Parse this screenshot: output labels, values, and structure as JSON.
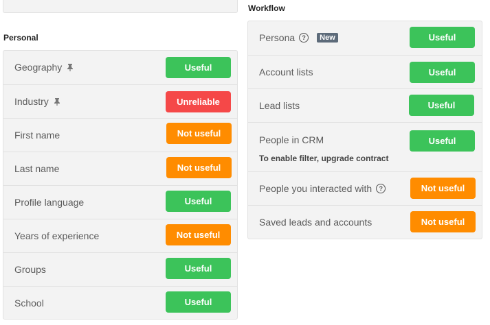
{
  "personal": {
    "heading": "Personal",
    "rows": [
      {
        "label": "Geography",
        "pinned": true,
        "status": "Useful",
        "status_kind": "useful"
      },
      {
        "label": "Industry",
        "pinned": true,
        "status": "Unreliable",
        "status_kind": "unreliable"
      },
      {
        "label": "First name",
        "status": "Not useful",
        "status_kind": "notuseful"
      },
      {
        "label": "Last name",
        "status": "Not useful",
        "status_kind": "notuseful"
      },
      {
        "label": "Profile language",
        "status": "Useful",
        "status_kind": "useful"
      },
      {
        "label": "Years of experience",
        "status": "Not useful",
        "status_kind": "notuseful"
      },
      {
        "label": "Groups",
        "status": "Useful",
        "status_kind": "useful"
      },
      {
        "label": "School",
        "status": "Useful",
        "status_kind": "useful"
      }
    ]
  },
  "workflow": {
    "heading": "Workflow",
    "rows": [
      {
        "label": "Persona",
        "help": true,
        "badge": "New",
        "status": "Useful",
        "status_kind": "useful"
      },
      {
        "label": "Account lists",
        "status": "Useful",
        "status_kind": "useful"
      },
      {
        "label": "Lead lists",
        "status": "Useful",
        "status_kind": "useful"
      },
      {
        "label": "People in CRM",
        "subtext": "To enable filter, upgrade contract",
        "status": "Useful",
        "status_kind": "useful"
      },
      {
        "label": "People you interacted with",
        "help": true,
        "status": "Not useful",
        "status_kind": "notuseful"
      },
      {
        "label": "Saved leads and accounts",
        "status": "Not useful",
        "status_kind": "notuseful"
      }
    ]
  },
  "icons": {
    "pin": "pin-icon",
    "help": "help-icon"
  },
  "colors": {
    "useful": "#3cc35a",
    "notuseful": "#ff8c00",
    "unreliable": "#f54848",
    "badge": "#5d6b7a"
  }
}
